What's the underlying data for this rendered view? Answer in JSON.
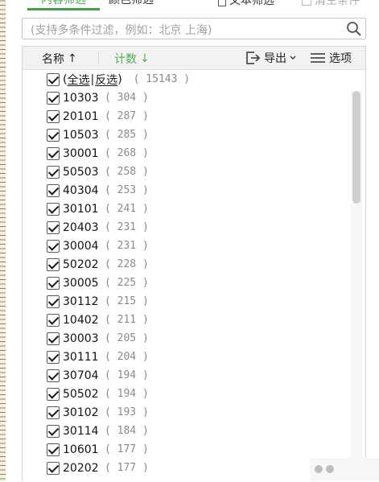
{
  "tabs": {
    "content_filter": "内容筛选",
    "color_filter": "颜色筛选",
    "text_filter": "文本筛选",
    "clear_conditions": "清空条件"
  },
  "search": {
    "placeholder": "(支持多条件过滤，例如：北京 上海)"
  },
  "header": {
    "name_label": "名称",
    "name_sort": "↑",
    "count_label": "计数",
    "count_sort": "↓",
    "export_label": "导出",
    "options_label": "选项"
  },
  "select_row": {
    "open": "(",
    "select_all": "全选",
    "separator": "|",
    "invert": "反选",
    "close": ")",
    "total": "( 15143 )"
  },
  "items": [
    {
      "code": "10303",
      "count": "( 304 )"
    },
    {
      "code": "20101",
      "count": "( 287 )"
    },
    {
      "code": "10503",
      "count": "( 285 )"
    },
    {
      "code": "30001",
      "count": "( 268 )"
    },
    {
      "code": "50503",
      "count": "( 258 )"
    },
    {
      "code": "40304",
      "count": "( 253 )"
    },
    {
      "code": "30101",
      "count": "( 241 )"
    },
    {
      "code": "20403",
      "count": "( 231 )"
    },
    {
      "code": "30004",
      "count": "( 231 )"
    },
    {
      "code": "50202",
      "count": "( 228 )"
    },
    {
      "code": "30005",
      "count": "( 225 )"
    },
    {
      "code": "30112",
      "count": "( 215 )"
    },
    {
      "code": "10402",
      "count": "( 211 )"
    },
    {
      "code": "30003",
      "count": "( 205 )"
    },
    {
      "code": "30111",
      "count": "( 204 )"
    },
    {
      "code": "30704",
      "count": "( 194 )"
    },
    {
      "code": "50502",
      "count": "( 194 )"
    },
    {
      "code": "30102",
      "count": "( 193 )"
    },
    {
      "code": "30114",
      "count": "( 184 )"
    },
    {
      "code": "10601",
      "count": "( 177 )"
    },
    {
      "code": "20202",
      "count": "( 177 )"
    }
  ],
  "colors": {
    "accent": "#4caf50",
    "muted": "#8a8a8a"
  }
}
